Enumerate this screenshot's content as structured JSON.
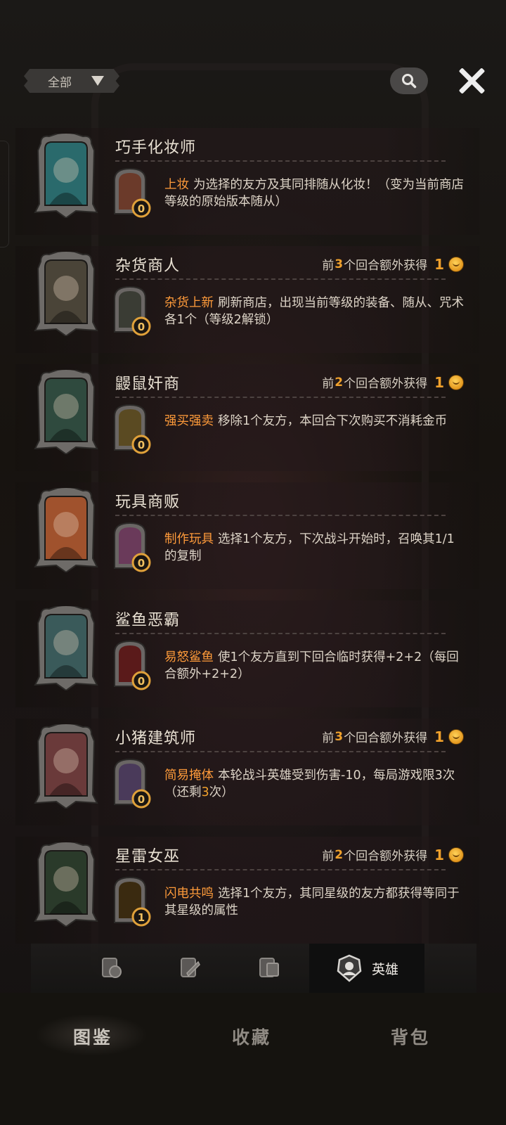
{
  "top": {
    "filter_label": "全部"
  },
  "heroes": [
    {
      "name": "巧手化妆师",
      "bonus": null,
      "skill_name": "上妆",
      "skill_text": "为选择的友方及其同排随从化妆！（变为当前商店等级的原始版本随从）",
      "cost": "0",
      "portrait_color": "#2a6a6c",
      "icon_color": "#6b3a2a"
    },
    {
      "name": "杂货商人",
      "bonus": {
        "prefix": "前",
        "turns": "3",
        "suffix": "个回合额外获得",
        "gold": "1"
      },
      "skill_name": "杂货上新",
      "skill_text": "刷新商店，出现当前等级的装备、随从、咒术各1个（等级2解锁）",
      "cost": "0",
      "portrait_color": "#4a4438",
      "icon_color": "#3a3c34"
    },
    {
      "name": "鼹鼠奸商",
      "bonus": {
        "prefix": "前",
        "turns": "2",
        "suffix": "个回合额外获得",
        "gold": "1"
      },
      "skill_name": "强买强卖",
      "skill_text": "移除1个友方，本回合下次购买不消耗金币",
      "cost": "0",
      "portrait_color": "#2f4a3e",
      "icon_color": "#5a4a22"
    },
    {
      "name": "玩具商贩",
      "bonus": null,
      "skill_name": "制作玩具",
      "skill_text": "选择1个友方，下次战斗开始时，召唤其1/1的复制",
      "cost": "0",
      "portrait_color": "#a0522d",
      "icon_color": "#6a3a5a"
    },
    {
      "name": "鲨鱼恶霸",
      "bonus": null,
      "skill_name": "易怒鲨鱼",
      "skill_text": "使1个友方直到下回合临时获得+2+2（每回合额外+2+2）",
      "cost": "0",
      "portrait_color": "#3a5a5a",
      "icon_color": "#5a1a1a"
    },
    {
      "name": "小猪建筑师",
      "bonus": {
        "prefix": "前",
        "turns": "3",
        "suffix": "个回合额外获得",
        "gold": "1"
      },
      "skill_name": "简易掩体",
      "skill_text_pre": "本轮战斗英雄受到伤害-10，每局游戏限3次（还剩",
      "skill_text_hl": "3",
      "skill_text_post": "次）",
      "cost": "0",
      "portrait_color": "#6a3a3a",
      "icon_color": "#4a3a5a"
    },
    {
      "name": "星雷女巫",
      "bonus": {
        "prefix": "前",
        "turns": "2",
        "suffix": "个回合额外获得",
        "gold": "1"
      },
      "skill_name": "闪电共鸣",
      "skill_text": "选择1个友方，其同星级的友方都获得等同于其星级的属性",
      "cost": "1",
      "portrait_color": "#2a3a2a",
      "icon_color": "#3a2a10"
    }
  ],
  "category_tabs": [
    {
      "label": "",
      "icon": "minion-card-icon"
    },
    {
      "label": "",
      "icon": "equipment-card-icon"
    },
    {
      "label": "",
      "icon": "spell-card-icon"
    },
    {
      "label": "英雄",
      "icon": "hero-icon"
    }
  ],
  "nav": {
    "codex": "图鉴",
    "collection": "收藏",
    "backpack": "背包"
  },
  "colors": {
    "accent": "#f0a12c",
    "skill_name": "#ff9b3a"
  }
}
